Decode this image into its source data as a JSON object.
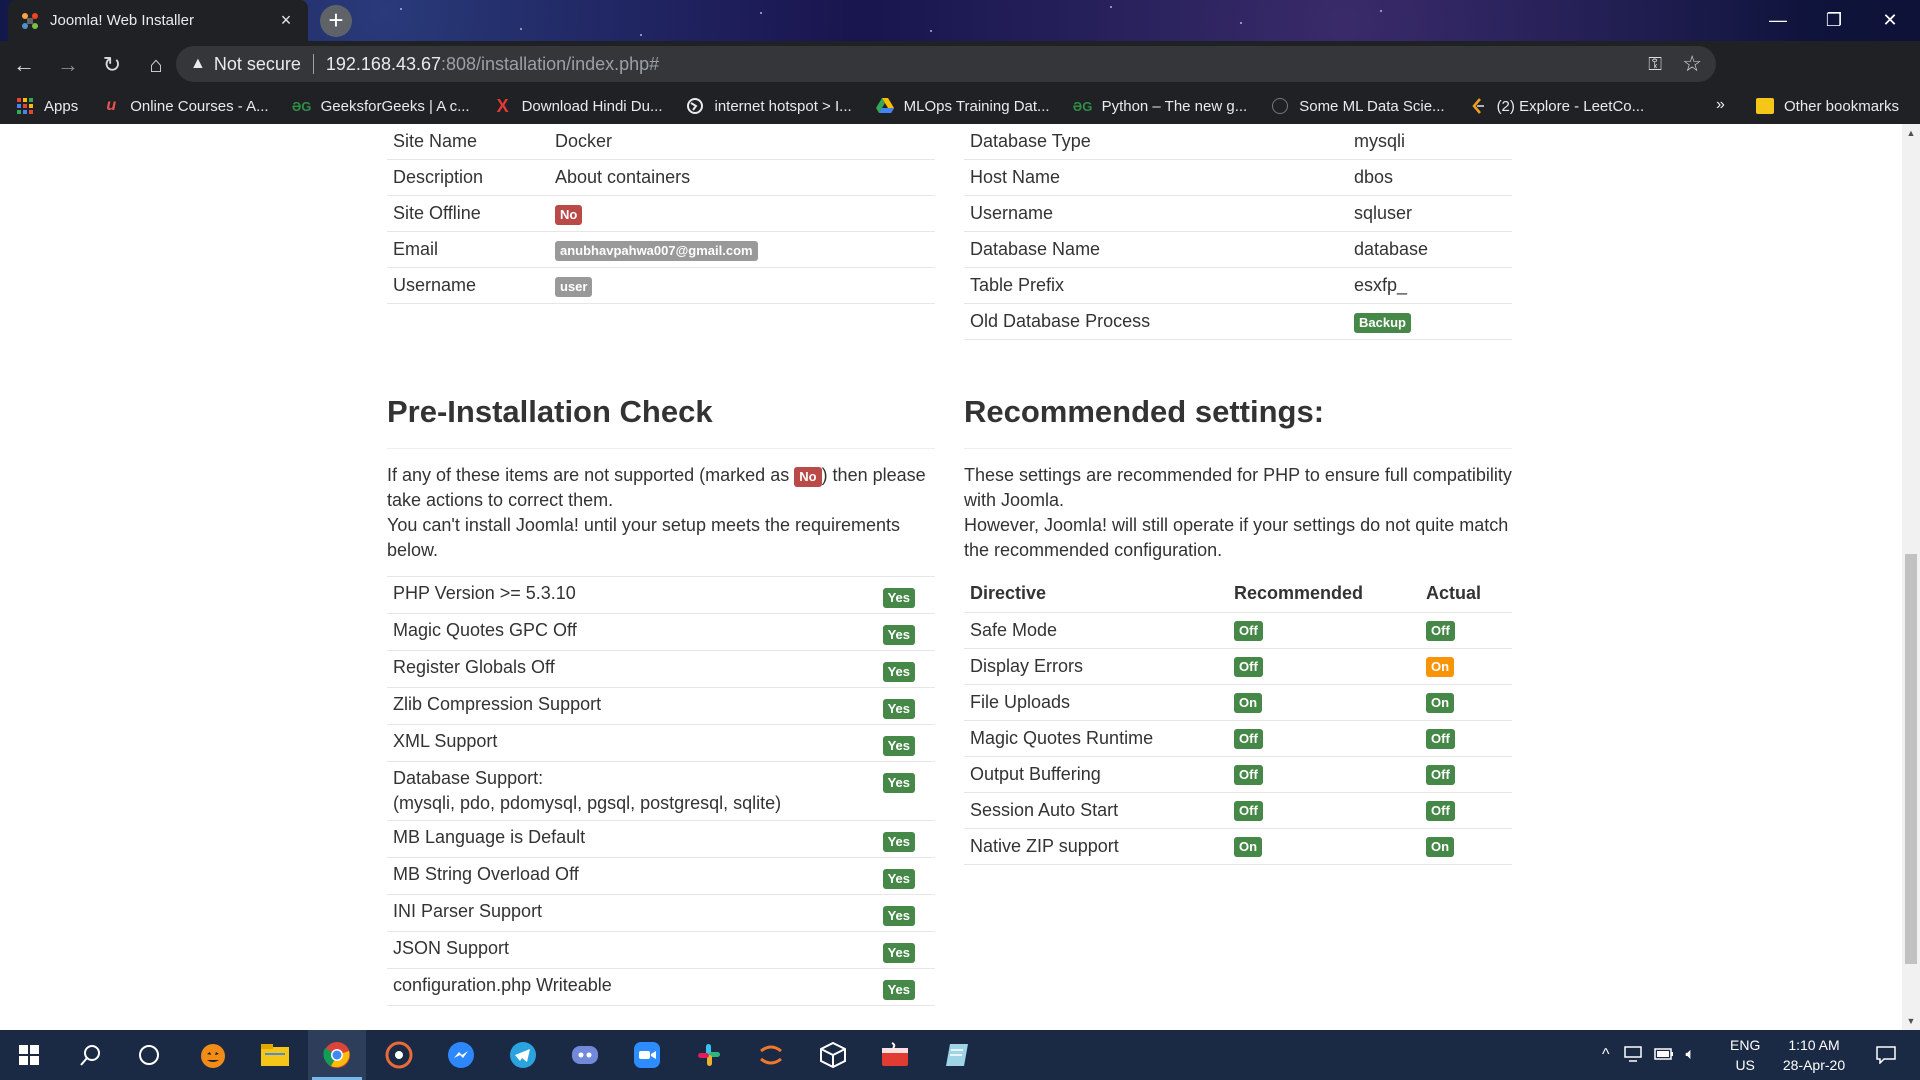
{
  "browser": {
    "tab_title": "Joomla! Web Installer",
    "tab_close": "×",
    "new_tab": "+",
    "security_label": "Not secure",
    "url_host": "192.168.43.67",
    "url_rest": ":808/installation/index.php#",
    "window_controls": {
      "minimize": "—",
      "restore": "❐",
      "close": "✕"
    }
  },
  "bookmarks": [
    {
      "label": "Apps",
      "icon": "apps-grid-icon"
    },
    {
      "label": "Online Courses - A...",
      "icon": "udemy-icon"
    },
    {
      "label": "GeeksforGeeks | A c...",
      "icon": "gfg-icon"
    },
    {
      "label": "Download Hindi Du...",
      "icon": "x-icon"
    },
    {
      "label": "internet hotspot > I...",
      "icon": "globe-icon"
    },
    {
      "label": "MLOps Training Dat...",
      "icon": "drive-icon"
    },
    {
      "label": "Python – The new g...",
      "icon": "gfg-icon"
    },
    {
      "label": "Some ML Data Scie...",
      "icon": "github-icon"
    },
    {
      "label": "(2) Explore - LeetCo...",
      "icon": "leetcode-icon"
    }
  ],
  "bookmarks_more": "»",
  "bookmarks_other": "Other bookmarks",
  "site_config": {
    "rows": [
      {
        "label": "Site Name",
        "value": "Docker"
      },
      {
        "label": "Description",
        "value": "About containers"
      },
      {
        "label": "Site Offline",
        "badge": "No"
      },
      {
        "label": "Email",
        "badge": "anubhavpahwa007@gmail.com"
      },
      {
        "label": "Username",
        "badge": "user"
      }
    ]
  },
  "db_config": {
    "rows": [
      {
        "label": "Database Type",
        "value": "mysqli"
      },
      {
        "label": "Host Name",
        "value": "dbos"
      },
      {
        "label": "Username",
        "value": "sqluser"
      },
      {
        "label": "Database Name",
        "value": "database"
      },
      {
        "label": "Table Prefix",
        "value": "esxfp_"
      },
      {
        "label": "Old Database Process",
        "badge": "Backup"
      }
    ]
  },
  "preinstall": {
    "heading": "Pre-Installation Check",
    "desc_before": "If any of these items are not supported (marked as ",
    "desc_badge": "No",
    "desc_after": ") then please take actions to correct them.",
    "desc_line2": "You can't install Joomla! until your setup meets the requirements below.",
    "items": [
      {
        "label": "PHP Version >= 5.3.10",
        "value": "Yes"
      },
      {
        "label": "Magic Quotes GPC Off",
        "value": "Yes"
      },
      {
        "label": "Register Globals Off",
        "value": "Yes"
      },
      {
        "label": "Zlib Compression Support",
        "value": "Yes"
      },
      {
        "label": "XML Support",
        "value": "Yes"
      },
      {
        "label": "Database Support:",
        "sublabel": "(mysqli, pdo, pdomysql, pgsql, postgresql, sqlite)",
        "value": "Yes"
      },
      {
        "label": "MB Language is Default",
        "value": "Yes"
      },
      {
        "label": "MB String Overload Off",
        "value": "Yes"
      },
      {
        "label": "INI Parser Support",
        "value": "Yes"
      },
      {
        "label": "JSON Support",
        "value": "Yes"
      },
      {
        "label": "configuration.php Writeable",
        "value": "Yes"
      }
    ]
  },
  "recommended": {
    "heading": "Recommended settings:",
    "desc_line1": "These settings are recommended for PHP to ensure full compatibility with Joomla.",
    "desc_line2": "However, Joomla! will still operate if your settings do not quite match the recommended configuration.",
    "columns": [
      "Directive",
      "Recommended",
      "Actual"
    ],
    "rows": [
      {
        "directive": "Safe Mode",
        "recommended": "Off",
        "actual": "Off",
        "actual_color": "green"
      },
      {
        "directive": "Display Errors",
        "recommended": "Off",
        "actual": "On",
        "actual_color": "orange"
      },
      {
        "directive": "File Uploads",
        "recommended": "On",
        "actual": "On",
        "actual_color": "green"
      },
      {
        "directive": "Magic Quotes Runtime",
        "recommended": "Off",
        "actual": "Off",
        "actual_color": "green"
      },
      {
        "directive": "Output Buffering",
        "recommended": "Off",
        "actual": "Off",
        "actual_color": "green"
      },
      {
        "directive": "Session Auto Start",
        "recommended": "Off",
        "actual": "Off",
        "actual_color": "green"
      },
      {
        "directive": "Native ZIP support",
        "recommended": "On",
        "actual": "On",
        "actual_color": "green"
      }
    ]
  },
  "colors": {
    "badge_red": "#b94a48",
    "badge_green": "#468847",
    "badge_orange": "#f89406",
    "badge_gray": "#999999"
  },
  "taskbar": {
    "lang": "ENG",
    "region": "US",
    "time": "1:10 AM",
    "date": "28-Apr-20",
    "apps": [
      "start-icon",
      "search-icon",
      "cortana-icon",
      "halloween-app-icon",
      "file-explorer-icon",
      "chrome-icon",
      "media-app-icon",
      "messenger-icon",
      "telegram-icon",
      "discord-icon",
      "zoom-icon",
      "slack-icon",
      "jupyter-icon",
      "virtualbox-icon",
      "java-icon",
      "notes-app-icon"
    ]
  }
}
